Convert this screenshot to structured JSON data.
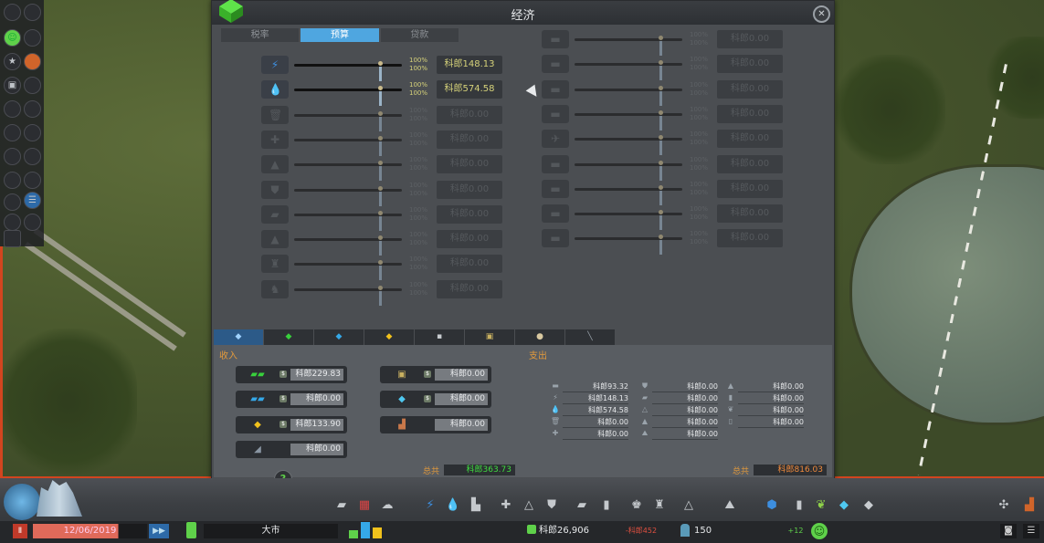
{
  "panel": {
    "title": "经济",
    "tabs": [
      {
        "label": "税率",
        "active": false
      },
      {
        "label": "预算",
        "active": true
      },
      {
        "label": "贷款",
        "active": false
      }
    ]
  },
  "budget_left": [
    {
      "icon": "electricity-icon",
      "glyph": "⚡",
      "active": true,
      "day_pct": "100%",
      "night_pct": "100%",
      "value": "科郎148.13"
    },
    {
      "icon": "water-icon",
      "glyph": "💧",
      "active": true,
      "day_pct": "100%",
      "night_pct": "100%",
      "value": "科郎574.58"
    },
    {
      "icon": "garbage-icon",
      "glyph": "🗑",
      "active": false,
      "day_pct": "100%",
      "night_pct": "100%",
      "value": "科郎0.00"
    },
    {
      "icon": "healthcare-icon",
      "glyph": "✚",
      "active": false,
      "day_pct": "100%",
      "night_pct": "100%",
      "value": "科郎0.00"
    },
    {
      "icon": "fire-icon",
      "glyph": "▲",
      "active": false,
      "day_pct": "100%",
      "night_pct": "100%",
      "value": "科郎0.00"
    },
    {
      "icon": "police-icon",
      "glyph": "⛊",
      "active": false,
      "day_pct": "100%",
      "night_pct": "100%",
      "value": "科郎0.00"
    },
    {
      "icon": "education-icon",
      "glyph": "▰",
      "active": false,
      "day_pct": "100%",
      "night_pct": "100%",
      "value": "科郎0.00"
    },
    {
      "icon": "monument-icon",
      "glyph": "▲",
      "active": false,
      "day_pct": "100%",
      "night_pct": "100%",
      "value": "科郎0.00"
    },
    {
      "icon": "landmark-icon",
      "glyph": "♜",
      "active": false,
      "day_pct": "100%",
      "night_pct": "100%",
      "value": "科郎0.00"
    },
    {
      "icon": "industry-icon",
      "glyph": "♞",
      "active": false,
      "day_pct": "100%",
      "night_pct": "100%",
      "value": "科郎0.00"
    }
  ],
  "budget_right": [
    {
      "icon": "bus-icon",
      "glyph": "▬",
      "day_pct": "100%",
      "night_pct": "100%",
      "value": "科郎0.00"
    },
    {
      "icon": "tram-icon",
      "glyph": "▬",
      "day_pct": "100%",
      "night_pct": "100%",
      "value": "科郎0.00"
    },
    {
      "icon": "metro-icon",
      "glyph": "▬",
      "day_pct": "100%",
      "night_pct": "100%",
      "value": "科郎0.00"
    },
    {
      "icon": "ship-icon",
      "glyph": "▬",
      "day_pct": "100%",
      "night_pct": "100%",
      "value": "科郎0.00"
    },
    {
      "icon": "plane-icon",
      "glyph": "✈",
      "day_pct": "100%",
      "night_pct": "100%",
      "value": "科郎0.00"
    },
    {
      "icon": "ferry-icon",
      "glyph": "▬",
      "day_pct": "100%",
      "night_pct": "100%",
      "value": "科郎0.00"
    },
    {
      "icon": "monorail-icon",
      "glyph": "▬",
      "day_pct": "100%",
      "night_pct": "100%",
      "value": "科郎0.00"
    },
    {
      "icon": "cable-car-icon",
      "glyph": "▬",
      "day_pct": "100%",
      "night_pct": "100%",
      "value": "科郎0.00"
    },
    {
      "icon": "taxi-icon",
      "glyph": "▬",
      "day_pct": "100%",
      "night_pct": "100%",
      "value": "科郎0.00"
    }
  ],
  "subtabs": [
    "",
    "",
    "",
    "",
    "",
    "",
    "",
    ""
  ],
  "income": {
    "title": "收入",
    "items": [
      {
        "icon": "residential-zone-icon",
        "color": "#38d13c",
        "value": "科郎229.83"
      },
      {
        "icon": "commercial-zone-icon",
        "color": "#35a8e8",
        "value": "科郎0.00"
      },
      {
        "icon": "industrial-zone-icon",
        "color": "#f2c21c",
        "value": "科郎133.90"
      },
      {
        "icon": "office-zone-icon",
        "color": "#7c8b9a",
        "value": "科郎0.00"
      },
      {
        "icon": "public-transport-income-icon",
        "color": "#c8b060",
        "value": "科郎0.00"
      },
      {
        "icon": "tourism-income-icon",
        "color": "#4fc8f0",
        "value": "科郎0.00"
      },
      {
        "icon": "industry-income-icon",
        "color": "#c8784a",
        "value": "科郎0.00"
      }
    ],
    "total_label": "总共",
    "total": "科郎363.73"
  },
  "expenses": {
    "title": "支出",
    "col1": [
      {
        "icon": "road-maintenance-icon",
        "value": "科郎93.32"
      },
      {
        "icon": "electricity-icon",
        "value": "科郎148.13"
      },
      {
        "icon": "water-icon",
        "value": "科郎574.58"
      },
      {
        "icon": "garbage-icon",
        "value": "科郎0.00"
      },
      {
        "icon": "healthcare-icon",
        "value": "科郎0.00"
      }
    ],
    "col2": [
      {
        "icon": "police-icon",
        "value": "科郎0.00"
      },
      {
        "icon": "education-icon",
        "value": "科郎0.00"
      },
      {
        "icon": "fire-icon",
        "value": "科郎0.00"
      },
      {
        "icon": "monument-icon",
        "value": "科郎0.00"
      },
      {
        "icon": "parks-icon",
        "value": "科郎0.00"
      }
    ],
    "col3": [
      {
        "icon": "policy-icon",
        "value": "科郎0.00"
      },
      {
        "icon": "public-transport-icon",
        "value": "科郎0.00"
      },
      {
        "icon": "beautification-icon",
        "value": "科郎0.00"
      },
      {
        "icon": "tourism-icon",
        "value": "科郎0.00"
      }
    ],
    "total_label": "总共",
    "total": "科郎816.03"
  },
  "status_bar": {
    "date": "12/06/2019",
    "city_name": "大市",
    "money": "科郎26,906",
    "money_delta": "-科郎452",
    "population": "150",
    "population_delta": "+12"
  },
  "colors": {
    "accent": "#4fa6e0",
    "income_total": "#3fdc3f",
    "expense_total": "#f08a3c",
    "warning_orange": "#e39a3c"
  }
}
